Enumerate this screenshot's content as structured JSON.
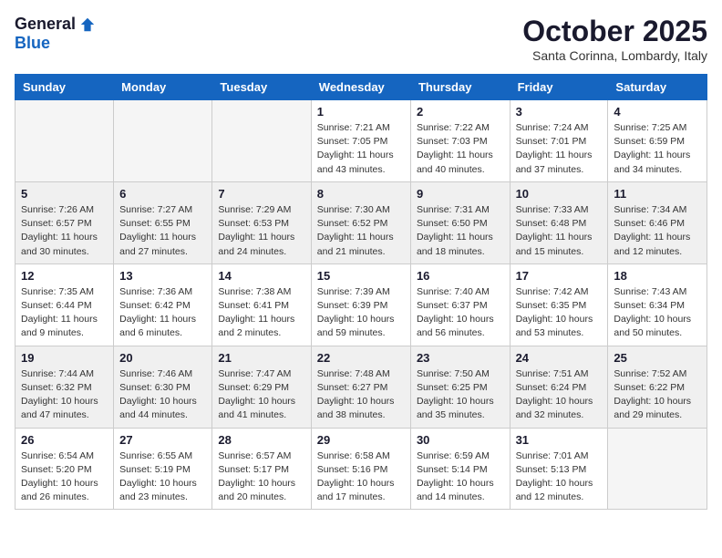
{
  "logo": {
    "general": "General",
    "blue": "Blue"
  },
  "title": {
    "month_year": "October 2025",
    "location": "Santa Corinna, Lombardy, Italy"
  },
  "headers": [
    "Sunday",
    "Monday",
    "Tuesday",
    "Wednesday",
    "Thursday",
    "Friday",
    "Saturday"
  ],
  "weeks": [
    [
      {
        "day": "",
        "info": ""
      },
      {
        "day": "",
        "info": ""
      },
      {
        "day": "",
        "info": ""
      },
      {
        "day": "1",
        "info": "Sunrise: 7:21 AM\nSunset: 7:05 PM\nDaylight: 11 hours\nand 43 minutes."
      },
      {
        "day": "2",
        "info": "Sunrise: 7:22 AM\nSunset: 7:03 PM\nDaylight: 11 hours\nand 40 minutes."
      },
      {
        "day": "3",
        "info": "Sunrise: 7:24 AM\nSunset: 7:01 PM\nDaylight: 11 hours\nand 37 minutes."
      },
      {
        "day": "4",
        "info": "Sunrise: 7:25 AM\nSunset: 6:59 PM\nDaylight: 11 hours\nand 34 minutes."
      }
    ],
    [
      {
        "day": "5",
        "info": "Sunrise: 7:26 AM\nSunset: 6:57 PM\nDaylight: 11 hours\nand 30 minutes."
      },
      {
        "day": "6",
        "info": "Sunrise: 7:27 AM\nSunset: 6:55 PM\nDaylight: 11 hours\nand 27 minutes."
      },
      {
        "day": "7",
        "info": "Sunrise: 7:29 AM\nSunset: 6:53 PM\nDaylight: 11 hours\nand 24 minutes."
      },
      {
        "day": "8",
        "info": "Sunrise: 7:30 AM\nSunset: 6:52 PM\nDaylight: 11 hours\nand 21 minutes."
      },
      {
        "day": "9",
        "info": "Sunrise: 7:31 AM\nSunset: 6:50 PM\nDaylight: 11 hours\nand 18 minutes."
      },
      {
        "day": "10",
        "info": "Sunrise: 7:33 AM\nSunset: 6:48 PM\nDaylight: 11 hours\nand 15 minutes."
      },
      {
        "day": "11",
        "info": "Sunrise: 7:34 AM\nSunset: 6:46 PM\nDaylight: 11 hours\nand 12 minutes."
      }
    ],
    [
      {
        "day": "12",
        "info": "Sunrise: 7:35 AM\nSunset: 6:44 PM\nDaylight: 11 hours\nand 9 minutes."
      },
      {
        "day": "13",
        "info": "Sunrise: 7:36 AM\nSunset: 6:42 PM\nDaylight: 11 hours\nand 6 minutes."
      },
      {
        "day": "14",
        "info": "Sunrise: 7:38 AM\nSunset: 6:41 PM\nDaylight: 11 hours\nand 2 minutes."
      },
      {
        "day": "15",
        "info": "Sunrise: 7:39 AM\nSunset: 6:39 PM\nDaylight: 10 hours\nand 59 minutes."
      },
      {
        "day": "16",
        "info": "Sunrise: 7:40 AM\nSunset: 6:37 PM\nDaylight: 10 hours\nand 56 minutes."
      },
      {
        "day": "17",
        "info": "Sunrise: 7:42 AM\nSunset: 6:35 PM\nDaylight: 10 hours\nand 53 minutes."
      },
      {
        "day": "18",
        "info": "Sunrise: 7:43 AM\nSunset: 6:34 PM\nDaylight: 10 hours\nand 50 minutes."
      }
    ],
    [
      {
        "day": "19",
        "info": "Sunrise: 7:44 AM\nSunset: 6:32 PM\nDaylight: 10 hours\nand 47 minutes."
      },
      {
        "day": "20",
        "info": "Sunrise: 7:46 AM\nSunset: 6:30 PM\nDaylight: 10 hours\nand 44 minutes."
      },
      {
        "day": "21",
        "info": "Sunrise: 7:47 AM\nSunset: 6:29 PM\nDaylight: 10 hours\nand 41 minutes."
      },
      {
        "day": "22",
        "info": "Sunrise: 7:48 AM\nSunset: 6:27 PM\nDaylight: 10 hours\nand 38 minutes."
      },
      {
        "day": "23",
        "info": "Sunrise: 7:50 AM\nSunset: 6:25 PM\nDaylight: 10 hours\nand 35 minutes."
      },
      {
        "day": "24",
        "info": "Sunrise: 7:51 AM\nSunset: 6:24 PM\nDaylight: 10 hours\nand 32 minutes."
      },
      {
        "day": "25",
        "info": "Sunrise: 7:52 AM\nSunset: 6:22 PM\nDaylight: 10 hours\nand 29 minutes."
      }
    ],
    [
      {
        "day": "26",
        "info": "Sunrise: 6:54 AM\nSunset: 5:20 PM\nDaylight: 10 hours\nand 26 minutes."
      },
      {
        "day": "27",
        "info": "Sunrise: 6:55 AM\nSunset: 5:19 PM\nDaylight: 10 hours\nand 23 minutes."
      },
      {
        "day": "28",
        "info": "Sunrise: 6:57 AM\nSunset: 5:17 PM\nDaylight: 10 hours\nand 20 minutes."
      },
      {
        "day": "29",
        "info": "Sunrise: 6:58 AM\nSunset: 5:16 PM\nDaylight: 10 hours\nand 17 minutes."
      },
      {
        "day": "30",
        "info": "Sunrise: 6:59 AM\nSunset: 5:14 PM\nDaylight: 10 hours\nand 14 minutes."
      },
      {
        "day": "31",
        "info": "Sunrise: 7:01 AM\nSunset: 5:13 PM\nDaylight: 10 hours\nand 12 minutes."
      },
      {
        "day": "",
        "info": ""
      }
    ]
  ]
}
